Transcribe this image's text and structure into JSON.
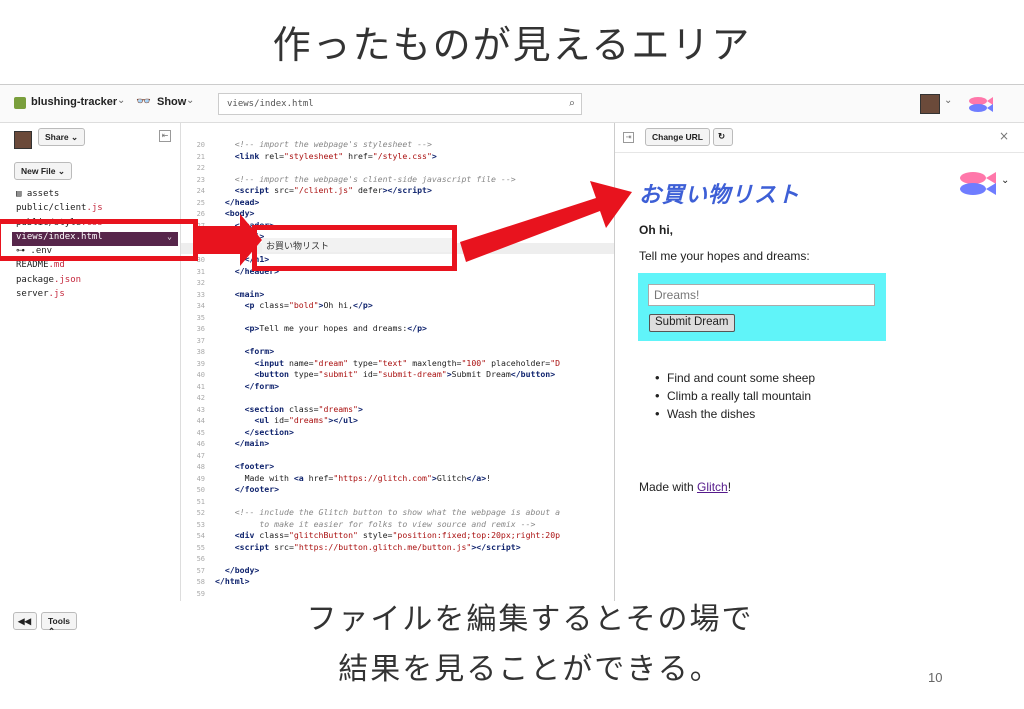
{
  "slide": {
    "title": "作ったものが見えるエリア",
    "caption_line1": "ファイルを編集するとその場で",
    "caption_line2": "結果を見ることができる。",
    "page_number": "10"
  },
  "topbar": {
    "project_name": "blushing-tracker",
    "show_label": "Show",
    "show_icon": "sunglasses-icon",
    "file_path": "views/index.html"
  },
  "sidebar": {
    "share_label": "Share",
    "new_file_label": "New File",
    "tools_label": "Tools",
    "files": [
      {
        "icon": "folder-icon",
        "name": "assets",
        "ext": ""
      },
      {
        "name": "public/client",
        "ext": ".js"
      },
      {
        "name": "public/style",
        "ext": ".css"
      },
      {
        "name": "views/index",
        "ext": ".html"
      },
      {
        "icon": "key-icon",
        "name": ".env",
        "ext": ""
      },
      {
        "name": "README",
        "ext": ".md"
      },
      {
        "name": "package",
        "ext": ".json"
      },
      {
        "name": "server",
        "ext": ".js"
      }
    ]
  },
  "editor": {
    "line_numbers": [
      "20",
      "21",
      "22",
      "23",
      "24",
      "25",
      "26",
      "27",
      "28",
      "29",
      "30",
      "31",
      "32",
      "33",
      "34",
      "35",
      "36",
      "37",
      "38",
      "39",
      "40",
      "41",
      "42",
      "43",
      "44",
      "45",
      "46",
      "47",
      "48",
      "49",
      "50",
      "51",
      "52",
      "53",
      "54",
      "55",
      "56",
      "57",
      "58",
      "59"
    ],
    "tooltip_text": "お買い物リスト"
  },
  "preview": {
    "change_url_label": "Change URL",
    "heading": "お買い物リスト",
    "greeting": "Oh hi,",
    "prompt": "Tell me your hopes and dreams:",
    "input_placeholder": "Dreams!",
    "submit_label": "Submit Dream",
    "dreams": [
      "Find and count some sheep",
      "Climb a really tall mountain",
      "Wash the dishes"
    ],
    "footer_prefix": "Made with ",
    "footer_link": "Glitch",
    "footer_suffix": "!"
  },
  "colors": {
    "callout": "#e8131e",
    "active_file_bg": "#57264b",
    "form_bg": "#60f4f9",
    "heading_blue": "#3d5fd6"
  }
}
